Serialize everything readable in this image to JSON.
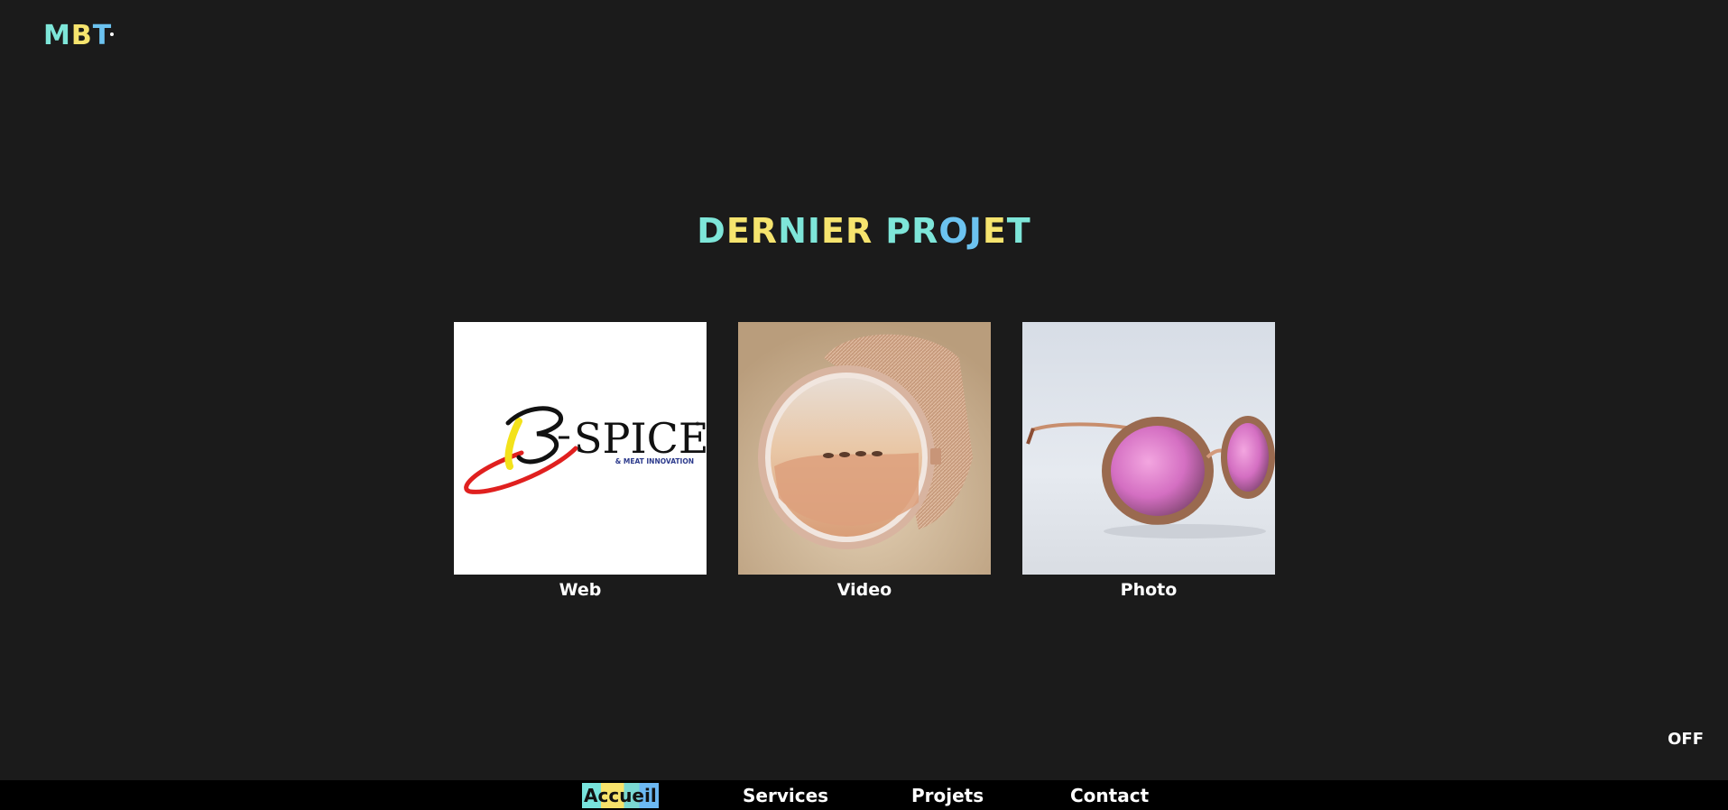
{
  "logo": {
    "letters": [
      "M",
      "B",
      "T"
    ],
    "colors": [
      "#7ee6d9",
      "#f6e46e",
      "#6cc3f0"
    ]
  },
  "section": {
    "title_letters": [
      "D",
      "E",
      "R",
      "N",
      "I",
      "E",
      "R",
      " ",
      "P",
      "R",
      "O",
      "J",
      "E",
      "T"
    ],
    "title_colors": [
      "#7ee6d9",
      "#f6e46e",
      "#f6e46e",
      "#7ee6d9",
      "#7ee6d9",
      "#f6e46e",
      "#f6e46e",
      "#000000",
      "#7ee6d9",
      "#7ee6d9",
      "#6cc3f0",
      "#6cc3f0",
      "#f6e46e",
      "#7ee6d9"
    ]
  },
  "cards": [
    {
      "label": "Web",
      "image": "bspice-logo"
    },
    {
      "label": "Video",
      "image": "watch-in-sand"
    },
    {
      "label": "Photo",
      "image": "wooden-sunglasses"
    }
  ],
  "bspice": {
    "brand": "SPICE",
    "tagline": "& MEAT INNOVATION"
  },
  "toggle": {
    "label": "OFF"
  },
  "nav": {
    "items": [
      {
        "label": "Accueil",
        "active": true
      },
      {
        "label": "Services",
        "active": false
      },
      {
        "label": "Projets",
        "active": false
      },
      {
        "label": "Contact",
        "active": false
      }
    ]
  },
  "colors": {
    "background": "#1b1b1b",
    "nav_background": "#000000",
    "teal": "#7ee6d9",
    "yellow": "#f6e46e",
    "blue": "#6cc3f0"
  }
}
